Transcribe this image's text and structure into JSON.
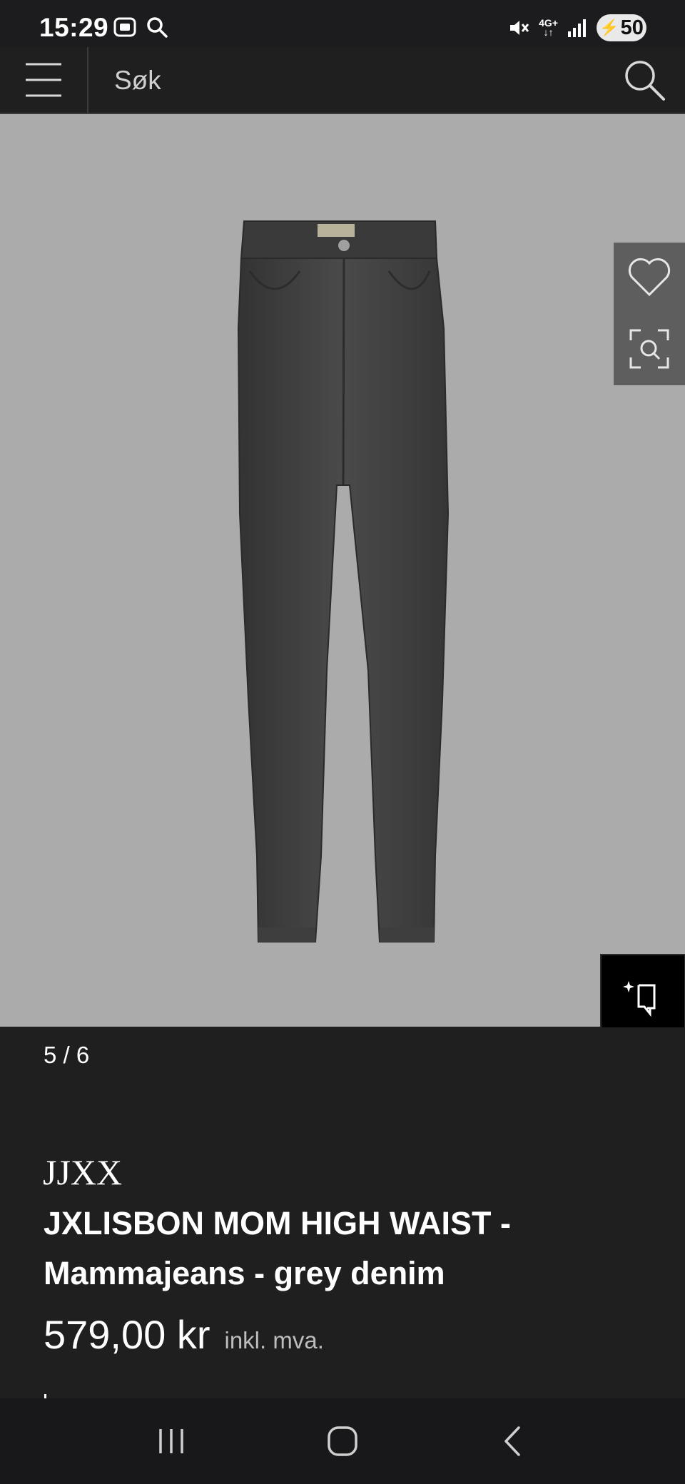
{
  "status_bar": {
    "time": "15:29",
    "network": "4G+",
    "battery": "50",
    "icons": [
      "screenshot-icon",
      "search-icon",
      "mute-icon",
      "signal-icon",
      "battery-icon"
    ]
  },
  "header": {
    "search_placeholder": "Søk",
    "icons": [
      "menu-icon",
      "search-icon"
    ]
  },
  "gallery": {
    "counter": "5 / 6",
    "background": "#ababab",
    "actions": [
      "heart-icon",
      "visual-search-icon",
      "ai-assist-icon"
    ]
  },
  "product": {
    "brand": "JJXX",
    "title": "JXLISBON MOM HIGH WAIST - Mammajeans - grey denim",
    "price": "579,00 kr",
    "vat_note": "inkl. mva."
  },
  "nav": {
    "icons": [
      "recent-apps-icon",
      "home-icon",
      "back-icon"
    ]
  }
}
